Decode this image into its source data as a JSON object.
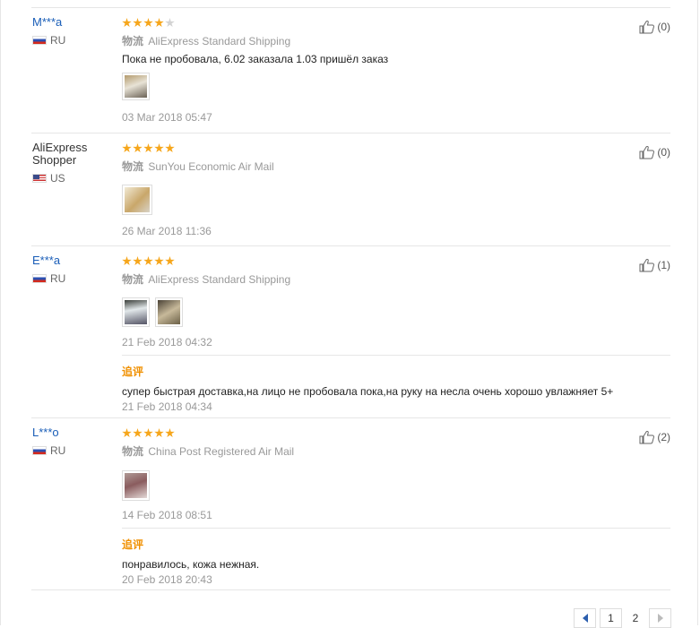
{
  "shipping_prefix": "物流",
  "feedback_label": "追评",
  "reviews": [
    {
      "username": "M***a",
      "country": "RU",
      "stars": 4,
      "shipping": "AliExpress Standard Shipping",
      "text": "Пока не пробовала, 6.02 заказала 1.03 пришёл заказ",
      "photos": 1,
      "date": "03 Mar 2018 05:47",
      "helpful": "(0)"
    },
    {
      "username": "AliExpress Shopper",
      "country": "US",
      "stars": 5,
      "shipping": "SunYou Economic Air Mail",
      "photos": 1,
      "date": "26 Mar 2018 11:36",
      "helpful": "(0)"
    },
    {
      "username": "E***a",
      "country": "RU",
      "stars": 5,
      "shipping": "AliExpress Standard Shipping",
      "photos": 2,
      "date": "21 Feb 2018 04:32",
      "helpful": "(1)",
      "followup_text": "супер быстрая доставка,на лицо не пробовала пока,на руку на несла очень хорошо увлажняет 5+",
      "followup_date": "21 Feb 2018 04:34"
    },
    {
      "username": "L***o",
      "country": "RU",
      "stars": 5,
      "shipping": "China Post Registered Air Mail",
      "photos": 1,
      "date": "14 Feb 2018 08:51",
      "helpful": "(2)",
      "followup_text": "понравилось, кожа нежная.",
      "followup_date": "20 Feb 2018 20:43"
    }
  ],
  "pagination": {
    "pages": [
      "1",
      "2"
    ],
    "current": "2"
  },
  "colors": {
    "star": "#f6a61b",
    "username_link": "#1a5eb8",
    "followup": "#f09000",
    "pager_arrow": "#2c5fae"
  },
  "icons": {
    "helpful": "thumbs-up-icon",
    "prev": "chevron-left-icon",
    "next": "chevron-right-icon"
  }
}
